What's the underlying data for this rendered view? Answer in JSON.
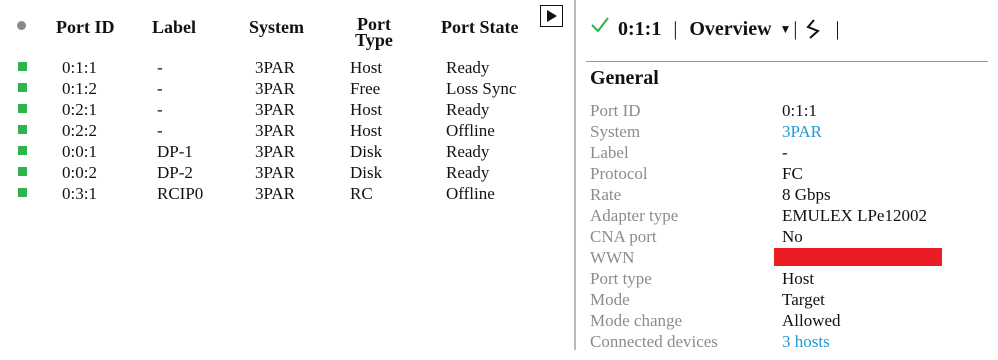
{
  "table": {
    "headers": {
      "port_id": "Port ID",
      "label": "Label",
      "system": "System",
      "port_type_line1": "Port",
      "port_type_line2": "Type",
      "port_state": "Port State"
    },
    "status_color": "#2db34a",
    "rows": [
      {
        "port_id": "0:1:1",
        "label": "-",
        "system": "3PAR",
        "type": "Host",
        "state": "Ready"
      },
      {
        "port_id": "0:1:2",
        "label": "-",
        "system": "3PAR",
        "type": "Free",
        "state": "Loss Sync"
      },
      {
        "port_id": "0:2:1",
        "label": "-",
        "system": "3PAR",
        "type": "Host",
        "state": "Ready"
      },
      {
        "port_id": "0:2:2",
        "label": "-",
        "system": "3PAR",
        "type": "Host",
        "state": "Offline"
      },
      {
        "port_id": "0:0:1",
        "label": "DP-1",
        "system": "3PAR",
        "type": "Disk",
        "state": "Ready"
      },
      {
        "port_id": "0:0:2",
        "label": "DP-2",
        "system": "3PAR",
        "type": "Disk",
        "state": "Ready"
      },
      {
        "port_id": "0:3:1",
        "label": "RCIP0",
        "system": "3PAR",
        "type": "RC",
        "state": "Offline"
      }
    ]
  },
  "detail": {
    "selected_port": "0:1:1",
    "view_selector": "Overview",
    "section_title": "General",
    "link_color": "#1f9bd8",
    "redaction_color": "#ea1c24",
    "properties": [
      {
        "key": "Port ID",
        "value": "0:1:1",
        "kind": "text"
      },
      {
        "key": "System",
        "value": "3PAR",
        "kind": "link"
      },
      {
        "key": "Label",
        "value": "-",
        "kind": "text"
      },
      {
        "key": "Protocol",
        "value": "FC",
        "kind": "text"
      },
      {
        "key": "Rate",
        "value": "8 Gbps",
        "kind": "text"
      },
      {
        "key": "Adapter type",
        "value": "EMULEX LPe12002",
        "kind": "text"
      },
      {
        "key": "CNA port",
        "value": "No",
        "kind": "text"
      },
      {
        "key": "WWN",
        "value": "",
        "kind": "redacted"
      },
      {
        "key": "Port type",
        "value": "Host",
        "kind": "text"
      },
      {
        "key": "Mode",
        "value": "Target",
        "kind": "text"
      },
      {
        "key": "Mode change",
        "value": "Allowed",
        "kind": "text"
      },
      {
        "key": "Connected devices",
        "value": "3 hosts",
        "kind": "link"
      }
    ]
  }
}
